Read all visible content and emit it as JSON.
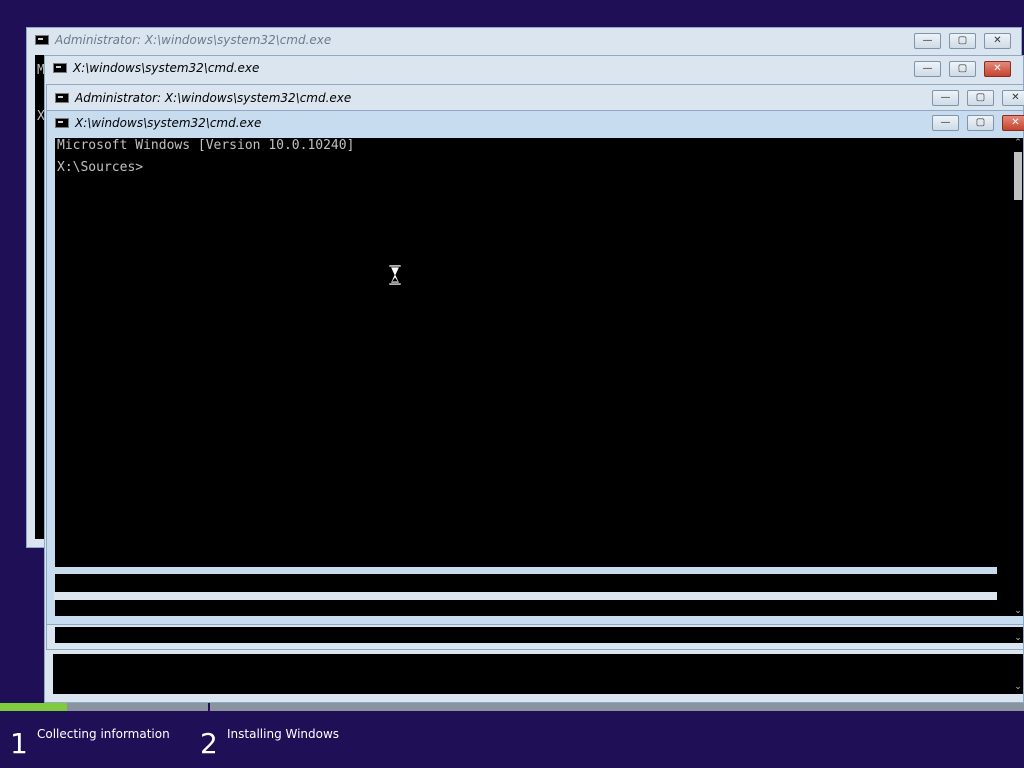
{
  "windows": {
    "win1": {
      "title": "Administrator: X:\\windows\\system32\\cmd.exe",
      "state": "inactive",
      "peek_chars": [
        "M",
        "X"
      ]
    },
    "win2": {
      "title": "X:\\windows\\system32\\cmd.exe",
      "state": "inactive"
    },
    "win3": {
      "title": "Administrator: X:\\windows\\system32\\cmd.exe",
      "state": "inactive"
    },
    "main": {
      "title": "X:\\windows\\system32\\cmd.exe",
      "state": "active",
      "console_lines": [
        "Microsoft Windows [Version 10.0.10240]",
        "X:\\Sources>"
      ]
    }
  },
  "controls": {
    "minimize": "—",
    "maximize": "▢",
    "close": "✕"
  },
  "setup": {
    "progress_fraction": 0.065,
    "steps": [
      {
        "number": "1",
        "label": "Collecting information"
      },
      {
        "number": "2",
        "label": "Installing Windows"
      }
    ]
  },
  "colors": {
    "desktop": "#1e0f57",
    "progress_fill": "#7ecb3d",
    "console_bg": "#000000",
    "console_text": "#c0c0c0"
  },
  "icons": [
    "cmd-app-icon",
    "hourglass-cursor-icon",
    "scroll-up-icon",
    "scroll-down-icon"
  ]
}
